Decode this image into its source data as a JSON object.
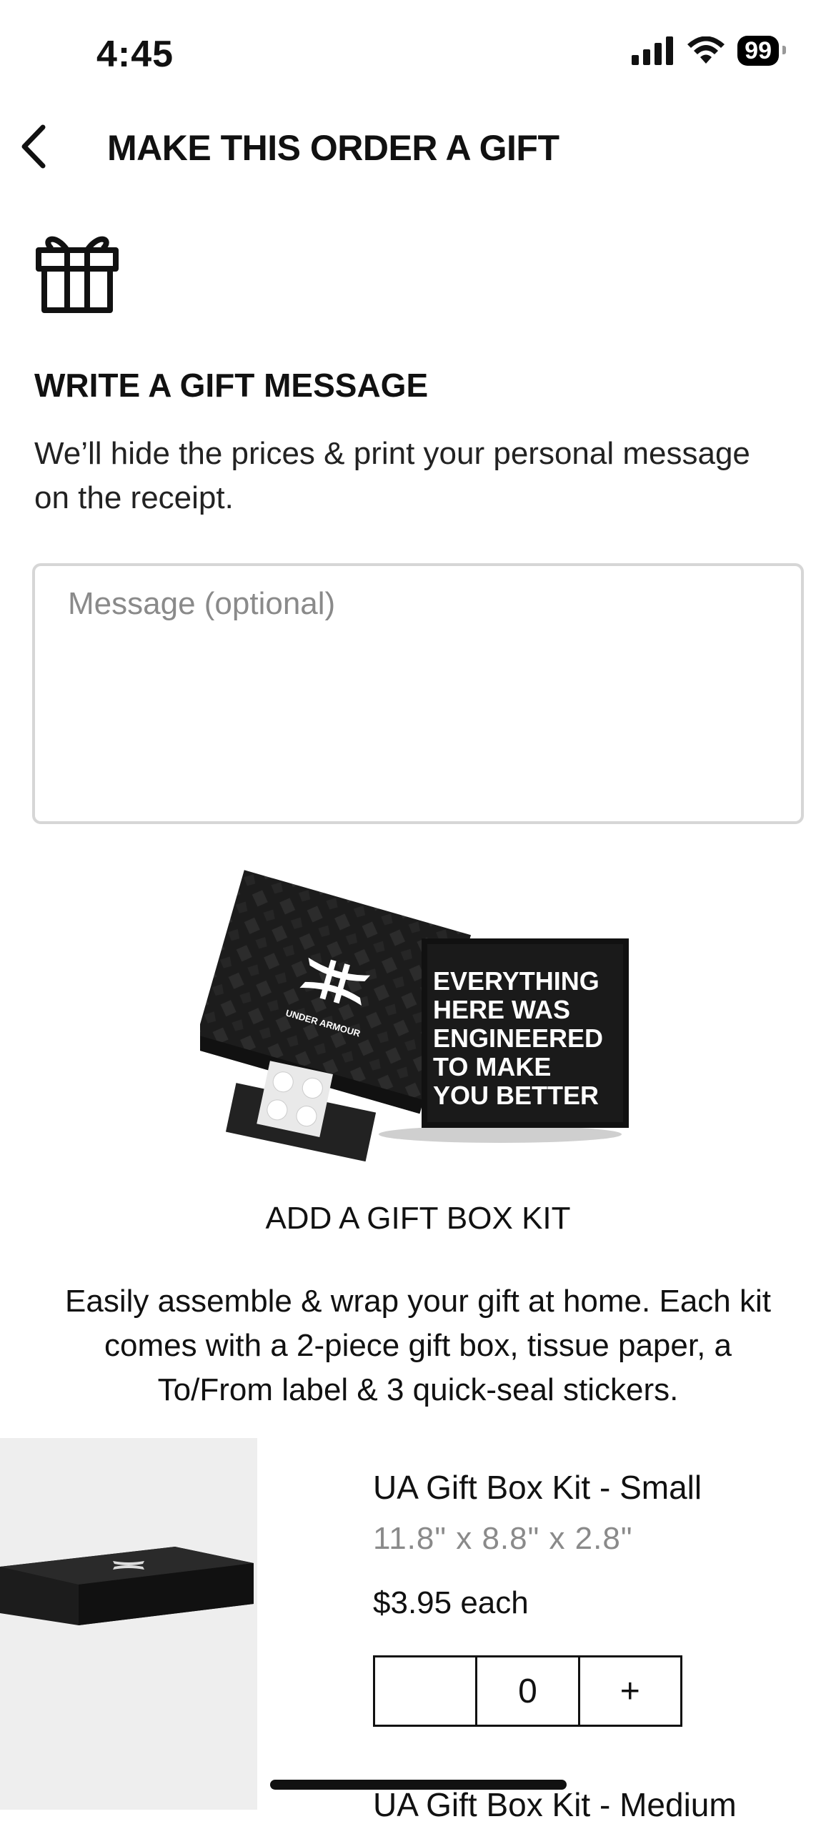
{
  "status_bar": {
    "time": "4:45",
    "battery": "99"
  },
  "header": {
    "title": "MAKE THIS ORDER A GIFT"
  },
  "gift_message": {
    "heading": "WRITE A GIFT MESSAGE",
    "description": "We’ll hide the prices & print your personal message on the receipt.",
    "placeholder": "Message (optional)",
    "value": ""
  },
  "box_illustration": {
    "brand": "UNDER ARMOUR",
    "lines": [
      "EVERYTHING",
      "HERE WAS",
      "ENGINEERED",
      "TO MAKE",
      "YOU BETTER"
    ]
  },
  "gift_box_kit": {
    "title": "ADD A GIFT BOX KIT",
    "description": "Easily assemble & wrap your gift at home. Each kit comes with a 2-piece gift box, tissue paper, a To/From label & 3 quick-seal stickers."
  },
  "products": [
    {
      "name": "UA Gift Box Kit - Small",
      "dimensions": "11.8\" x 8.8\" x 2.8\"",
      "price": "$3.95 each",
      "quantity": "0",
      "increment_label": "+",
      "decrement_label": ""
    },
    {
      "name": "UA Gift Box Kit - Medium"
    }
  ],
  "icons": {
    "back": "chevron-left-icon",
    "gift": "gift-icon",
    "signal": "cellular-signal-icon",
    "wifi": "wifi-icon",
    "battery": "battery-icon"
  }
}
